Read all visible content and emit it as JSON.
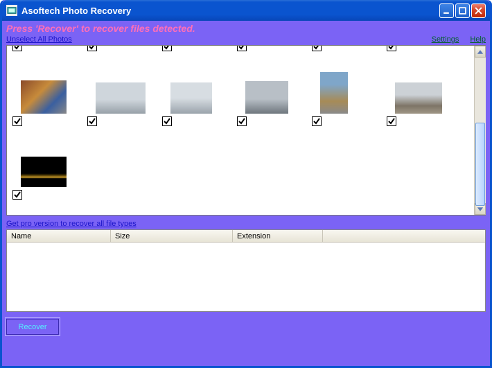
{
  "window": {
    "title": "Asoftech Photo Recovery"
  },
  "instruction": "Press 'Recover' to recover files detected.",
  "links": {
    "unselect_all": "Unselect All Photos",
    "settings": "Settings",
    "help": "Help",
    "pro": "Get pro version to recover all file types"
  },
  "table": {
    "columns": {
      "name": "Name",
      "size": "Size",
      "ext": "Extension"
    },
    "rows": []
  },
  "buttons": {
    "recover": "Recover"
  },
  "photos": {
    "top_row_count": 6,
    "row2": [
      {
        "kind": "crowd",
        "checked": true
      },
      {
        "kind": "runner1",
        "checked": true
      },
      {
        "kind": "runner2",
        "checked": true
      },
      {
        "kind": "cars",
        "checked": true
      },
      {
        "kind": "runner3",
        "checked": true
      },
      {
        "kind": "plaza",
        "checked": true
      }
    ],
    "row3": [
      {
        "kind": "night",
        "checked": true
      }
    ]
  }
}
